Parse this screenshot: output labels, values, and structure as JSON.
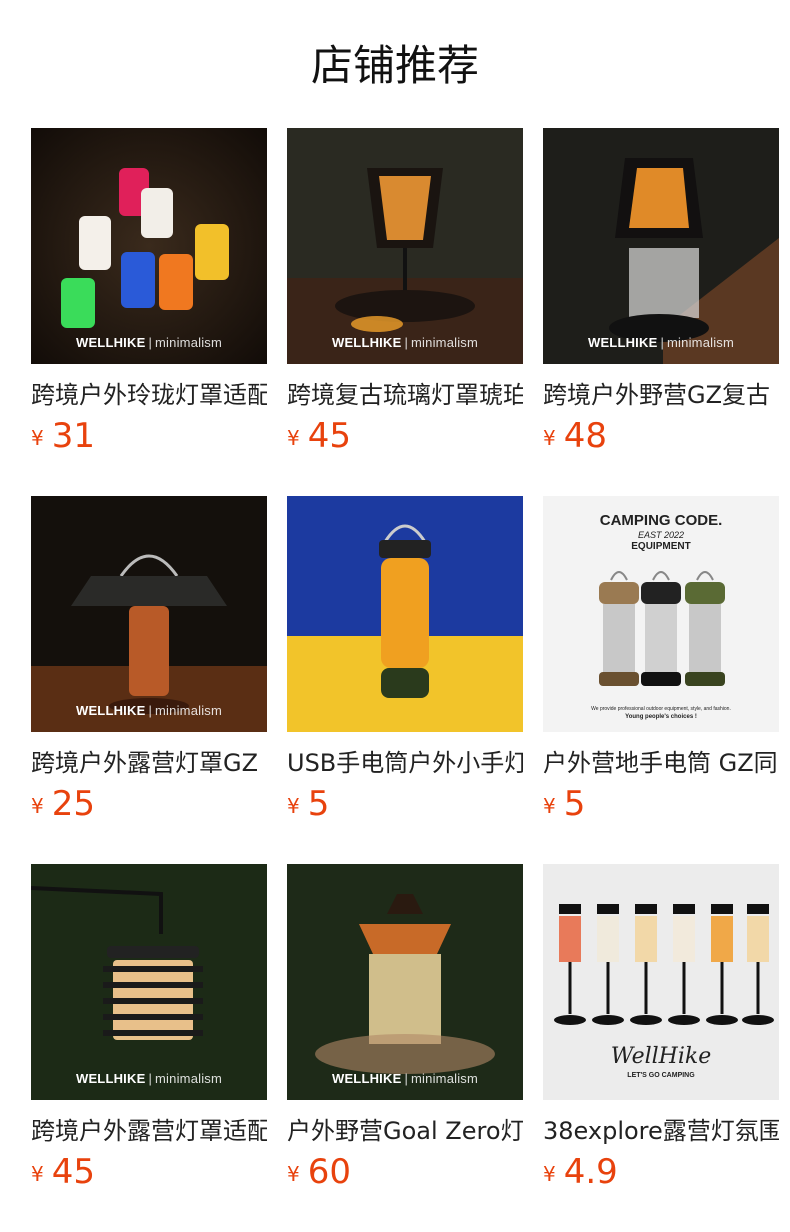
{
  "header": {
    "title": "店铺推荐"
  },
  "currency_symbol": "¥",
  "brand": {
    "name": "WELLHIKE",
    "sub": "minimalism"
  },
  "products": [
    {
      "name": "跨境户外玲珑灯罩适配",
      "price": "31"
    },
    {
      "name": "跨境复古琉璃灯罩琥珀",
      "price": "45"
    },
    {
      "name": "跨境户外野营GZ复古",
      "price": "48"
    },
    {
      "name": "跨境户外露营灯罩GZ",
      "price": "25"
    },
    {
      "name": "USB手电筒户外小手灯",
      "price": "5"
    },
    {
      "name": "户外营地手电筒 GZ同",
      "price": "5"
    },
    {
      "name": "跨境户外露营灯罩适配",
      "price": "45"
    },
    {
      "name": "户外野营Goal Zero灯",
      "price": "60"
    },
    {
      "name": "38explore露营灯氛围",
      "price": "4.9"
    }
  ],
  "image_text": {
    "camping_code_line1": "CAMPING CODE.",
    "camping_code_line2": "EAST 2022",
    "camping_code_line3": "EQUIPMENT",
    "camping_code_footer1": "We provide professional outdoor equipment, style, and fashion.",
    "camping_code_footer2": "Young people's choices !",
    "wellhike_script": "WellHike",
    "lets_go": "LET'S GO CAMPING"
  },
  "colors": {
    "price": "#e8420d",
    "title": "#111111",
    "name": "#222222"
  }
}
